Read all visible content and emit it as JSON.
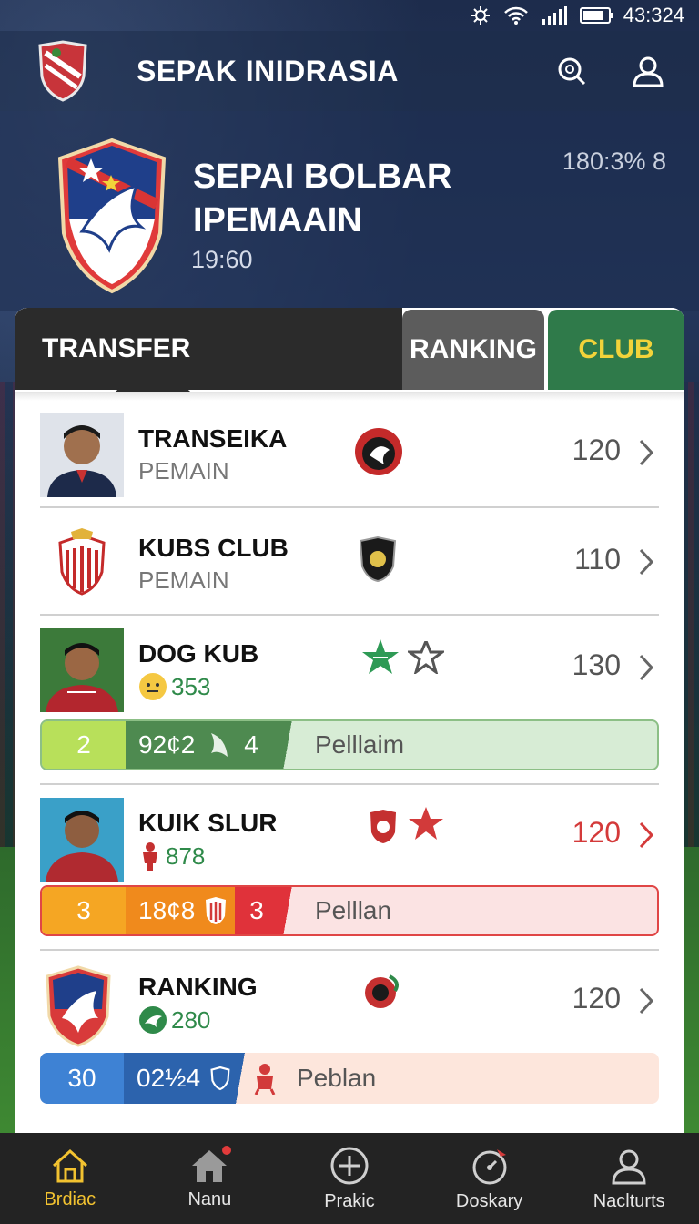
{
  "status_bar": {
    "time": "43:324"
  },
  "app_bar": {
    "title": "SEPAK INIDRASIA",
    "search_icon": "search-icon",
    "profile_icon": "user-icon"
  },
  "hero": {
    "title_line1": "SEPAI BOLBAR",
    "title_line2": "IPEMAAIN",
    "subtitle": "19:60",
    "meta": "180:3% 8"
  },
  "tabs": [
    {
      "label": "TRANSFER",
      "active": true
    },
    {
      "label": "RANKING",
      "active": false
    },
    {
      "label": "CLUB",
      "active": false
    }
  ],
  "rows": [
    {
      "name": "TRANSEIKA",
      "sub": "PEMAIN",
      "score": "120"
    },
    {
      "name": "KUBS CLUB",
      "sub": "PEMAIN",
      "score": "110"
    },
    {
      "name": "DOG KUB",
      "stat": "353",
      "score": "130",
      "bar": {
        "a": "2",
        "b": "92¢2",
        "c": "4",
        "label": "Pelllaim"
      }
    },
    {
      "name": "KUIK SLUR",
      "stat": "878",
      "score": "120",
      "bar": {
        "a": "3",
        "b": "18¢8",
        "c": "3",
        "label": "Pelllan"
      }
    },
    {
      "name": "RANKING",
      "stat": "280",
      "score": "120",
      "bar": {
        "a": "30",
        "b": "02½4",
        "label": "Peblan"
      }
    }
  ],
  "bottom_nav": [
    {
      "label": "Brdiac",
      "icon": "home-icon",
      "active": true
    },
    {
      "label": "Nanu",
      "icon": "house-icon",
      "active": false
    },
    {
      "label": "Prakic",
      "icon": "plus-circle-icon",
      "active": false
    },
    {
      "label": "Doskary",
      "icon": "timer-icon",
      "active": false
    },
    {
      "label": "Naclturts",
      "icon": "user-icon",
      "active": false
    }
  ],
  "colors": {
    "accent_green": "#2f7a4a",
    "accent_yellow": "#f2c230",
    "score_red": "#d43a3a"
  }
}
